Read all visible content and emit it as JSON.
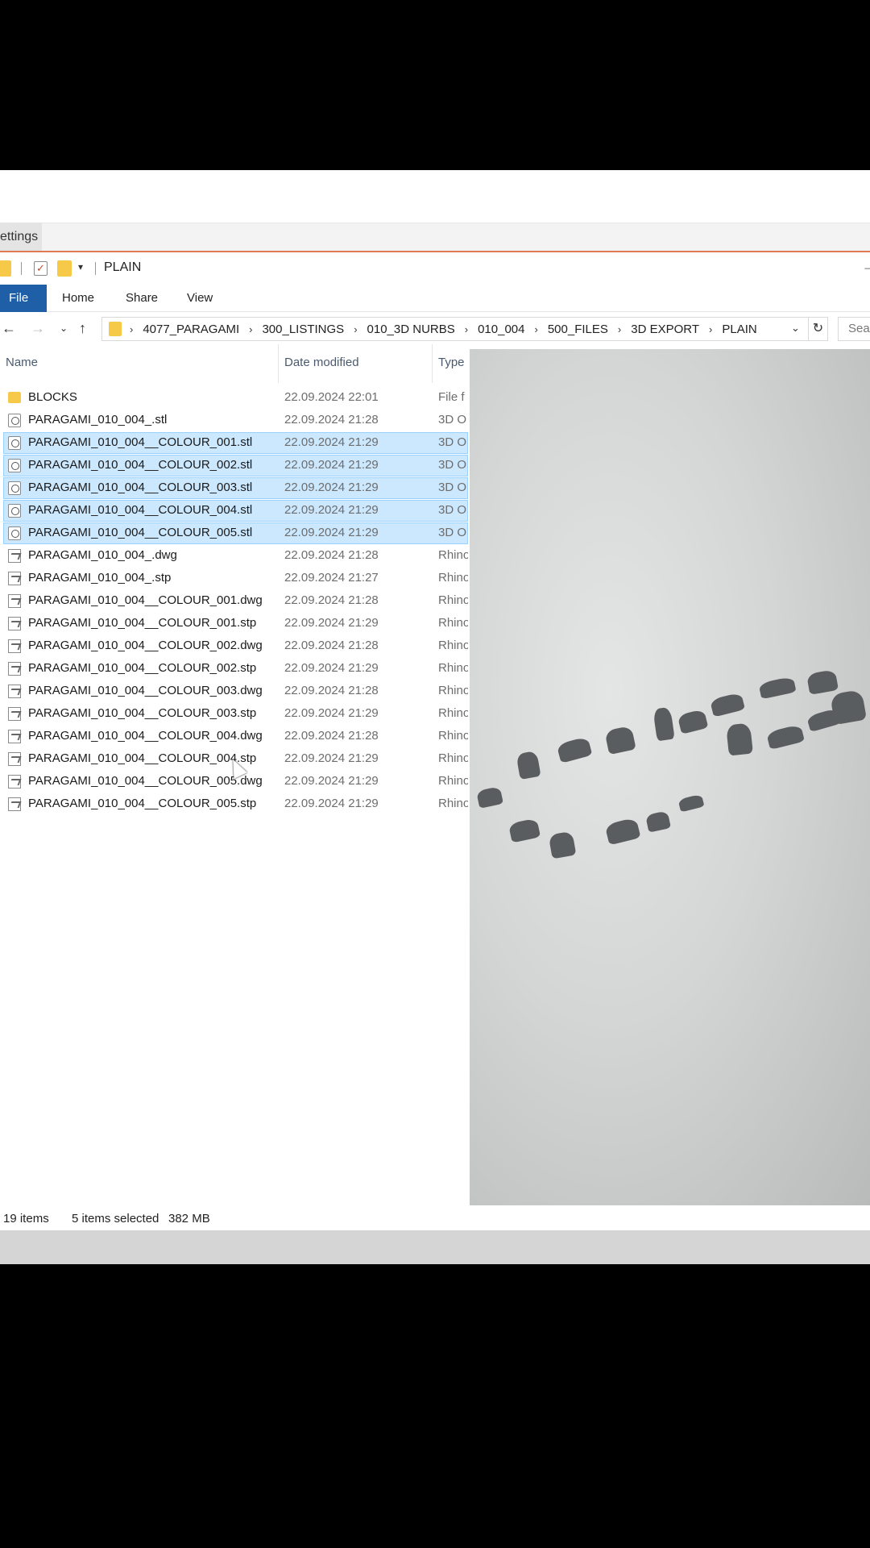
{
  "background_tab": {
    "label": "ettings"
  },
  "titlebar": {
    "title": "PLAIN"
  },
  "ribbon": {
    "file": "File",
    "home": "Home",
    "share": "Share",
    "view": "View"
  },
  "address": {
    "crumbs": [
      "4077_PARAGAMI",
      "300_LISTINGS",
      "010_3D NURBS",
      "010_004",
      "500_FILES",
      "3D EXPORT",
      "PLAIN"
    ],
    "search_placeholder": "Sear"
  },
  "columns": {
    "name": "Name",
    "date": "Date modified",
    "type": "Type"
  },
  "files": [
    {
      "name": "BLOCKS",
      "date": "22.09.2024 22:01",
      "type": "File f",
      "icon": "folder-icon",
      "selected": false
    },
    {
      "name": "PARAGAMI_010_004_.stl",
      "date": "22.09.2024 21:28",
      "type": "3D O",
      "icon": "stl-file-icon",
      "selected": false
    },
    {
      "name": "PARAGAMI_010_004__COLOUR_001.stl",
      "date": "22.09.2024 21:29",
      "type": "3D O",
      "icon": "stl-file-icon",
      "selected": true
    },
    {
      "name": "PARAGAMI_010_004__COLOUR_002.stl",
      "date": "22.09.2024 21:29",
      "type": "3D O",
      "icon": "stl-file-icon",
      "selected": true
    },
    {
      "name": "PARAGAMI_010_004__COLOUR_003.stl",
      "date": "22.09.2024 21:29",
      "type": "3D O",
      "icon": "stl-file-icon",
      "selected": true
    },
    {
      "name": "PARAGAMI_010_004__COLOUR_004.stl",
      "date": "22.09.2024 21:29",
      "type": "3D O",
      "icon": "stl-file-icon",
      "selected": true
    },
    {
      "name": "PARAGAMI_010_004__COLOUR_005.stl",
      "date": "22.09.2024 21:29",
      "type": "3D O",
      "icon": "stl-file-icon",
      "selected": true
    },
    {
      "name": "PARAGAMI_010_004_.dwg",
      "date": "22.09.2024 21:28",
      "type": "Rhino",
      "icon": "rhino-file-icon",
      "selected": false
    },
    {
      "name": "PARAGAMI_010_004_.stp",
      "date": "22.09.2024 21:27",
      "type": "Rhino",
      "icon": "rhino-file-icon",
      "selected": false
    },
    {
      "name": "PARAGAMI_010_004__COLOUR_001.dwg",
      "date": "22.09.2024 21:28",
      "type": "Rhino",
      "icon": "rhino-file-icon",
      "selected": false
    },
    {
      "name": "PARAGAMI_010_004__COLOUR_001.stp",
      "date": "22.09.2024 21:29",
      "type": "Rhino",
      "icon": "rhino-file-icon",
      "selected": false
    },
    {
      "name": "PARAGAMI_010_004__COLOUR_002.dwg",
      "date": "22.09.2024 21:28",
      "type": "Rhino",
      "icon": "rhino-file-icon",
      "selected": false
    },
    {
      "name": "PARAGAMI_010_004__COLOUR_002.stp",
      "date": "22.09.2024 21:29",
      "type": "Rhino",
      "icon": "rhino-file-icon",
      "selected": false
    },
    {
      "name": "PARAGAMI_010_004__COLOUR_003.dwg",
      "date": "22.09.2024 21:28",
      "type": "Rhino",
      "icon": "rhino-file-icon",
      "selected": false
    },
    {
      "name": "PARAGAMI_010_004__COLOUR_003.stp",
      "date": "22.09.2024 21:29",
      "type": "Rhino",
      "icon": "rhino-file-icon",
      "selected": false
    },
    {
      "name": "PARAGAMI_010_004__COLOUR_004.dwg",
      "date": "22.09.2024 21:28",
      "type": "Rhino",
      "icon": "rhino-file-icon",
      "selected": false
    },
    {
      "name": "PARAGAMI_010_004__COLOUR_004.stp",
      "date": "22.09.2024 21:29",
      "type": "Rhino",
      "icon": "rhino-file-icon",
      "selected": false
    },
    {
      "name": "PARAGAMI_010_004__COLOUR_005.dwg",
      "date": "22.09.2024 21:29",
      "type": "Rhino",
      "icon": "rhino-file-icon",
      "selected": false
    },
    {
      "name": "PARAGAMI_010_004__COLOUR_005.stp",
      "date": "22.09.2024 21:29",
      "type": "Rhino",
      "icon": "rhino-file-icon",
      "selected": false
    }
  ],
  "status": {
    "item_count": "19 items",
    "selection": "5 items selected",
    "size": "382 MB"
  },
  "colors": {
    "selection_fill": "#cce8ff",
    "selection_border": "#99d1ff",
    "file_tab": "#1f5fa8",
    "folder": "#f7c948",
    "accent_line": "#e07a55"
  }
}
